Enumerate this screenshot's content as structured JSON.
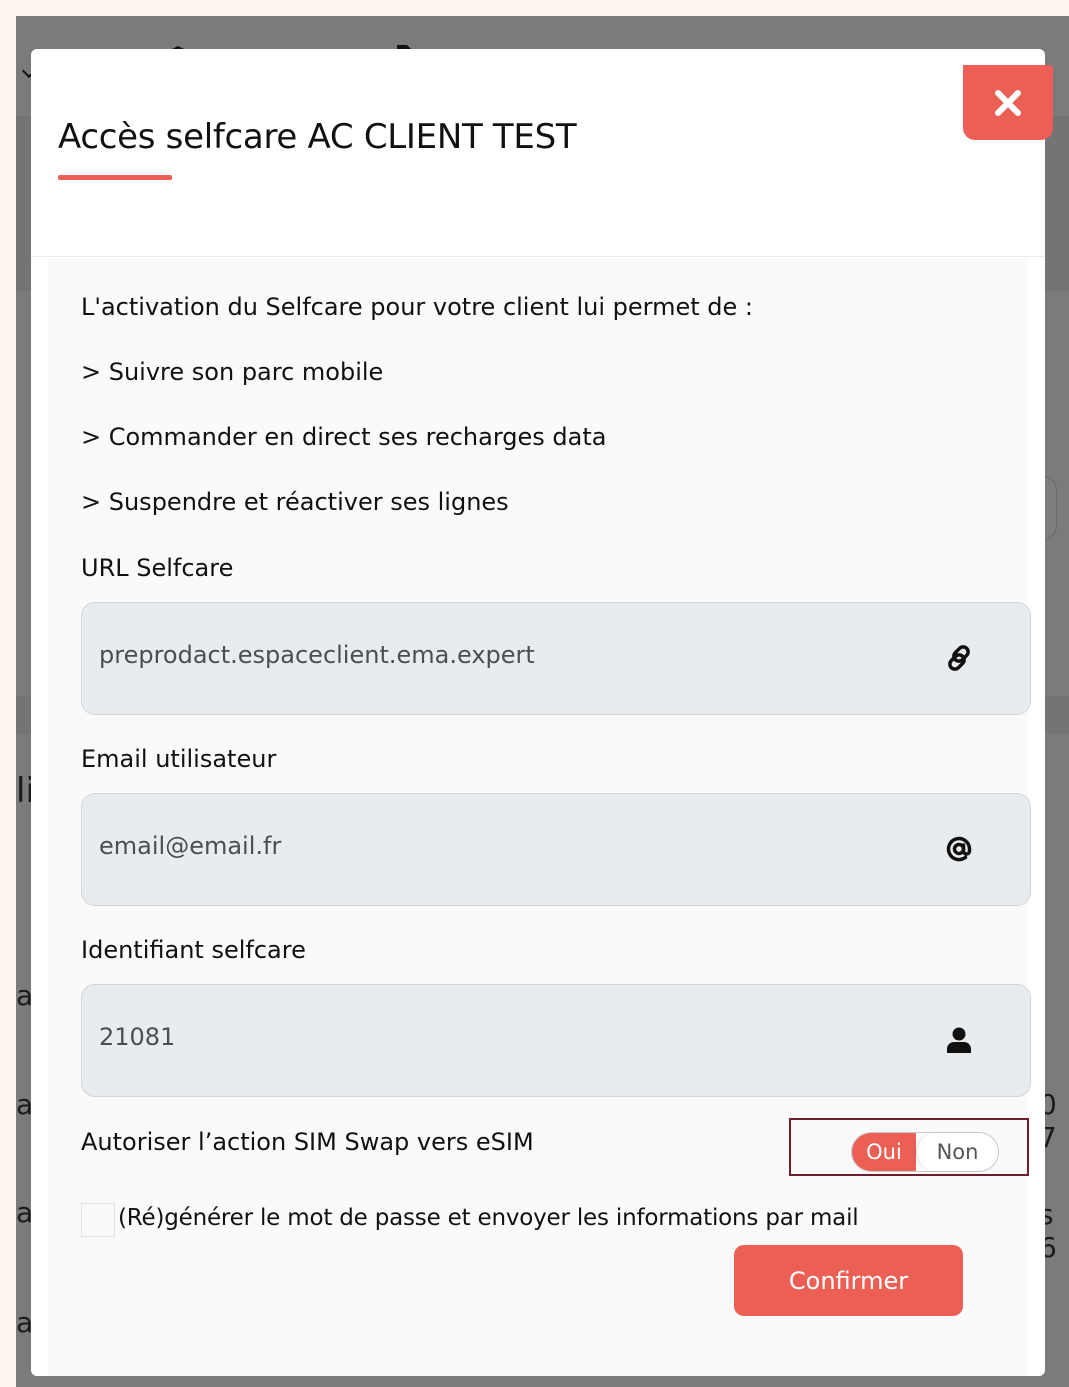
{
  "background": {
    "fragments": [
      "li",
      "a",
      "a",
      "a",
      "a",
      "0 7",
      "s 6"
    ]
  },
  "modal": {
    "title": "Accès selfcare AC CLIENT TEST",
    "close_icon": "close-icon",
    "intro": "L'activation du Selfcare pour votre client lui permet de :",
    "features": [
      "> Suivre son parc mobile",
      "> Commander en direct ses recharges data",
      "> Suspendre et réactiver ses lignes"
    ],
    "fields": {
      "url": {
        "label": "URL Selfcare",
        "value": "preprodact.espaceclient.ema.expert",
        "icon": "link-icon"
      },
      "email": {
        "label": "Email utilisateur",
        "value": "email@email.fr",
        "icon": "at-icon"
      },
      "identifier": {
        "label": "Identifiant selfcare",
        "value": "21081",
        "icon": "user-icon"
      }
    },
    "sim_swap": {
      "label": "Autoriser l’action SIM Swap vers eSIM",
      "on_label": "Oui",
      "off_label": "Non",
      "state": "Oui"
    },
    "regenerate": {
      "label": "(Ré)générer le mot de passe et envoyer les informations par mail",
      "checked": false
    },
    "confirm_label": "Confirmer"
  },
  "colors": {
    "accent": "#eb5f55",
    "overlay": "#7b7b7b",
    "field_bg": "#e9ecef",
    "toggle_focus_border": "#6e1d2b"
  }
}
